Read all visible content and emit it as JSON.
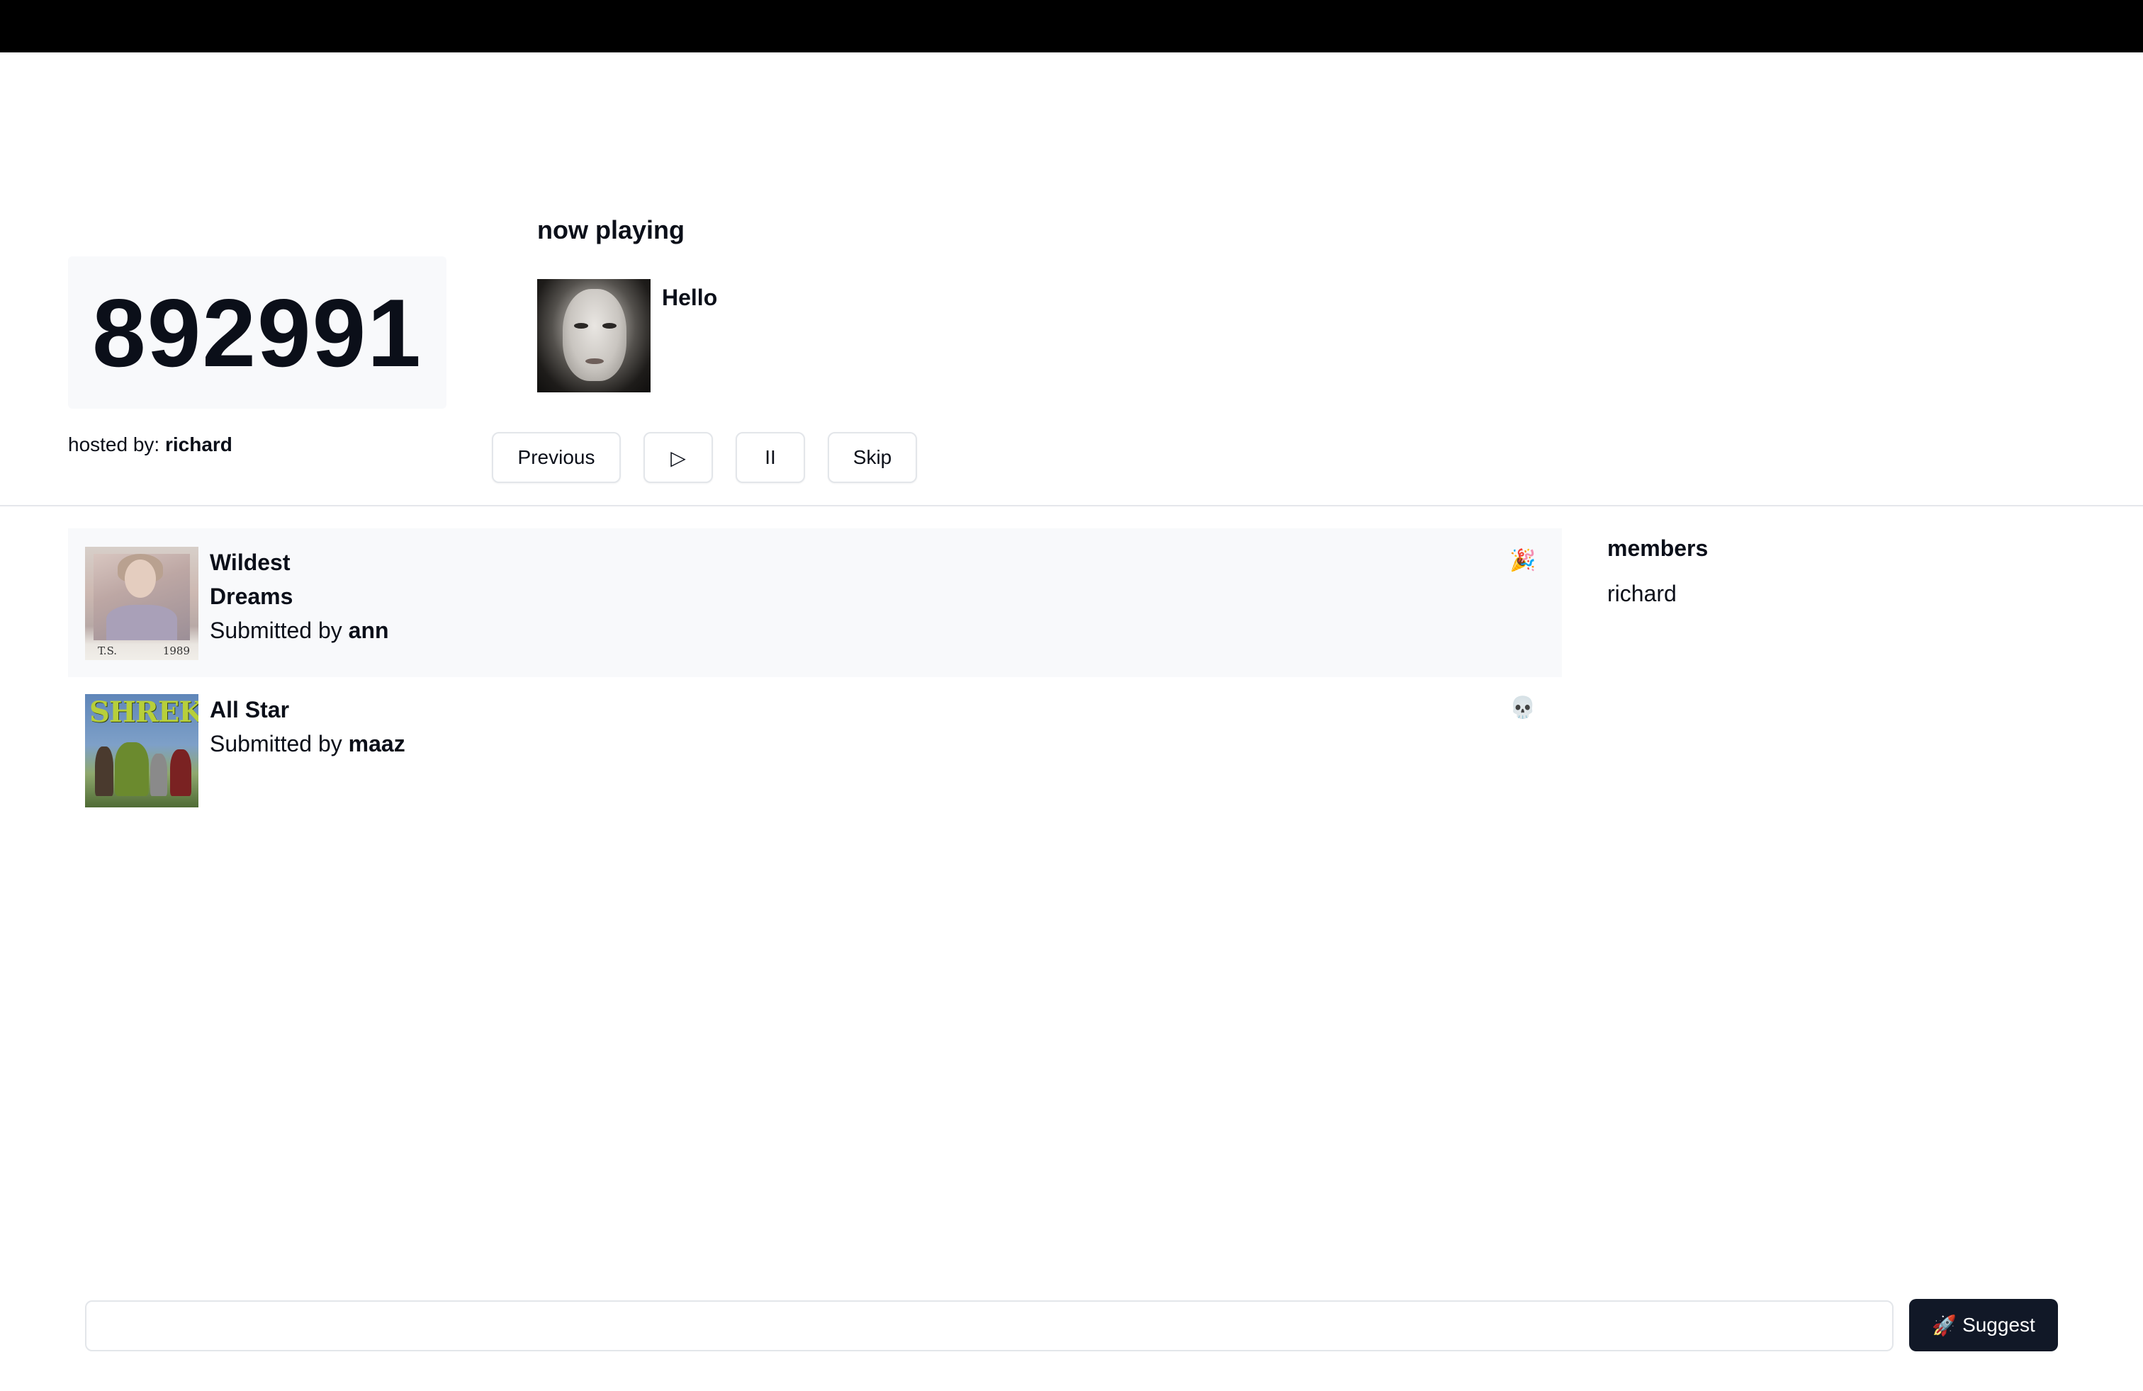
{
  "room": {
    "code": "892991",
    "hosted_by_label": "hosted by:",
    "host": "richard"
  },
  "now_playing": {
    "heading": "now playing",
    "song": "Hello"
  },
  "controls": {
    "previous": "Previous",
    "play": "▷",
    "pause": "II",
    "skip": "Skip"
  },
  "queue": [
    {
      "title": "Wildest Dreams",
      "submitted_label": "Submitted by",
      "submitter": "ann",
      "reaction": "🎉"
    },
    {
      "title": "All Star",
      "submitted_label": "Submitted by",
      "submitter": "maaz",
      "reaction": "💀"
    }
  ],
  "album_art": {
    "first_caption_left": "T.S.",
    "first_caption_right": "1989",
    "second_logo": "SHREK"
  },
  "members": {
    "heading": "members",
    "list": [
      "richard"
    ]
  },
  "suggest": {
    "placeholder": "",
    "button_icon": "🚀",
    "button_label": "Suggest"
  },
  "colors": {
    "primary_button": "#111827",
    "card_bg": "#f8f9fb",
    "border": "#e3e6ea"
  }
}
